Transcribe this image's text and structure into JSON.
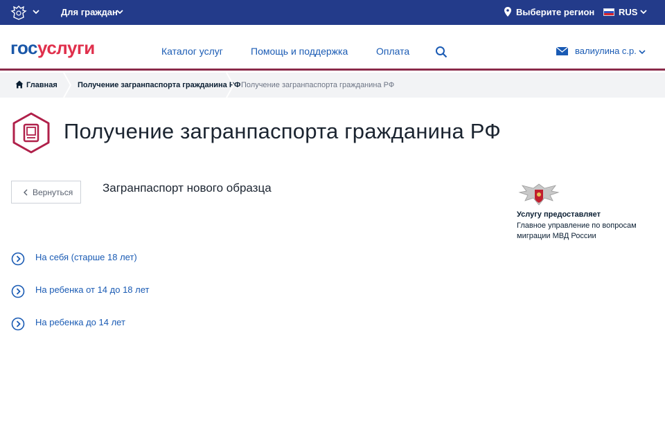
{
  "topbar": {
    "for_citizens": "Для граждан",
    "region": "Выберите регион",
    "lang": "RUS"
  },
  "header": {
    "logo_gos": "гос",
    "logo_uslugi": "услуги",
    "nav": [
      {
        "label": "Каталог услуг"
      },
      {
        "label": "Помощь и поддержка"
      },
      {
        "label": "Оплата"
      }
    ],
    "user": "валиулина с.р."
  },
  "breadcrumb": {
    "home": "Главная",
    "parent": "Получение загранпаспорта гражданина РФ",
    "current": "Получение загранпаспорта гражданина РФ"
  },
  "page": {
    "title": "Получение загранпаспорта гражданина РФ",
    "back": "Вернуться",
    "subtitle": "Загранпаспорт нового образца",
    "options": [
      {
        "label": "На себя (старше 18 лет)"
      },
      {
        "label": "На ребенка от 14 до 18 лет"
      },
      {
        "label": "На ребенка до 14 лет"
      }
    ]
  },
  "provider": {
    "heading": "Услугу предоставляет",
    "name": "Главное управление по вопросам миграции МВД России"
  },
  "colors": {
    "topbar": "#233b8a",
    "link": "#1a5bb4",
    "accent": "#b0204a",
    "logo_blue": "#1a57a8",
    "logo_red": "#e0304c"
  },
  "icons": [
    "coat-of-arms-icon",
    "chevron-down-icon",
    "location-pin-icon",
    "russia-flag-icon",
    "search-icon",
    "mail-icon",
    "home-icon",
    "passport-icon",
    "chevron-left-icon",
    "chevron-right-circle-icon",
    "mvd-emblem-icon"
  ]
}
